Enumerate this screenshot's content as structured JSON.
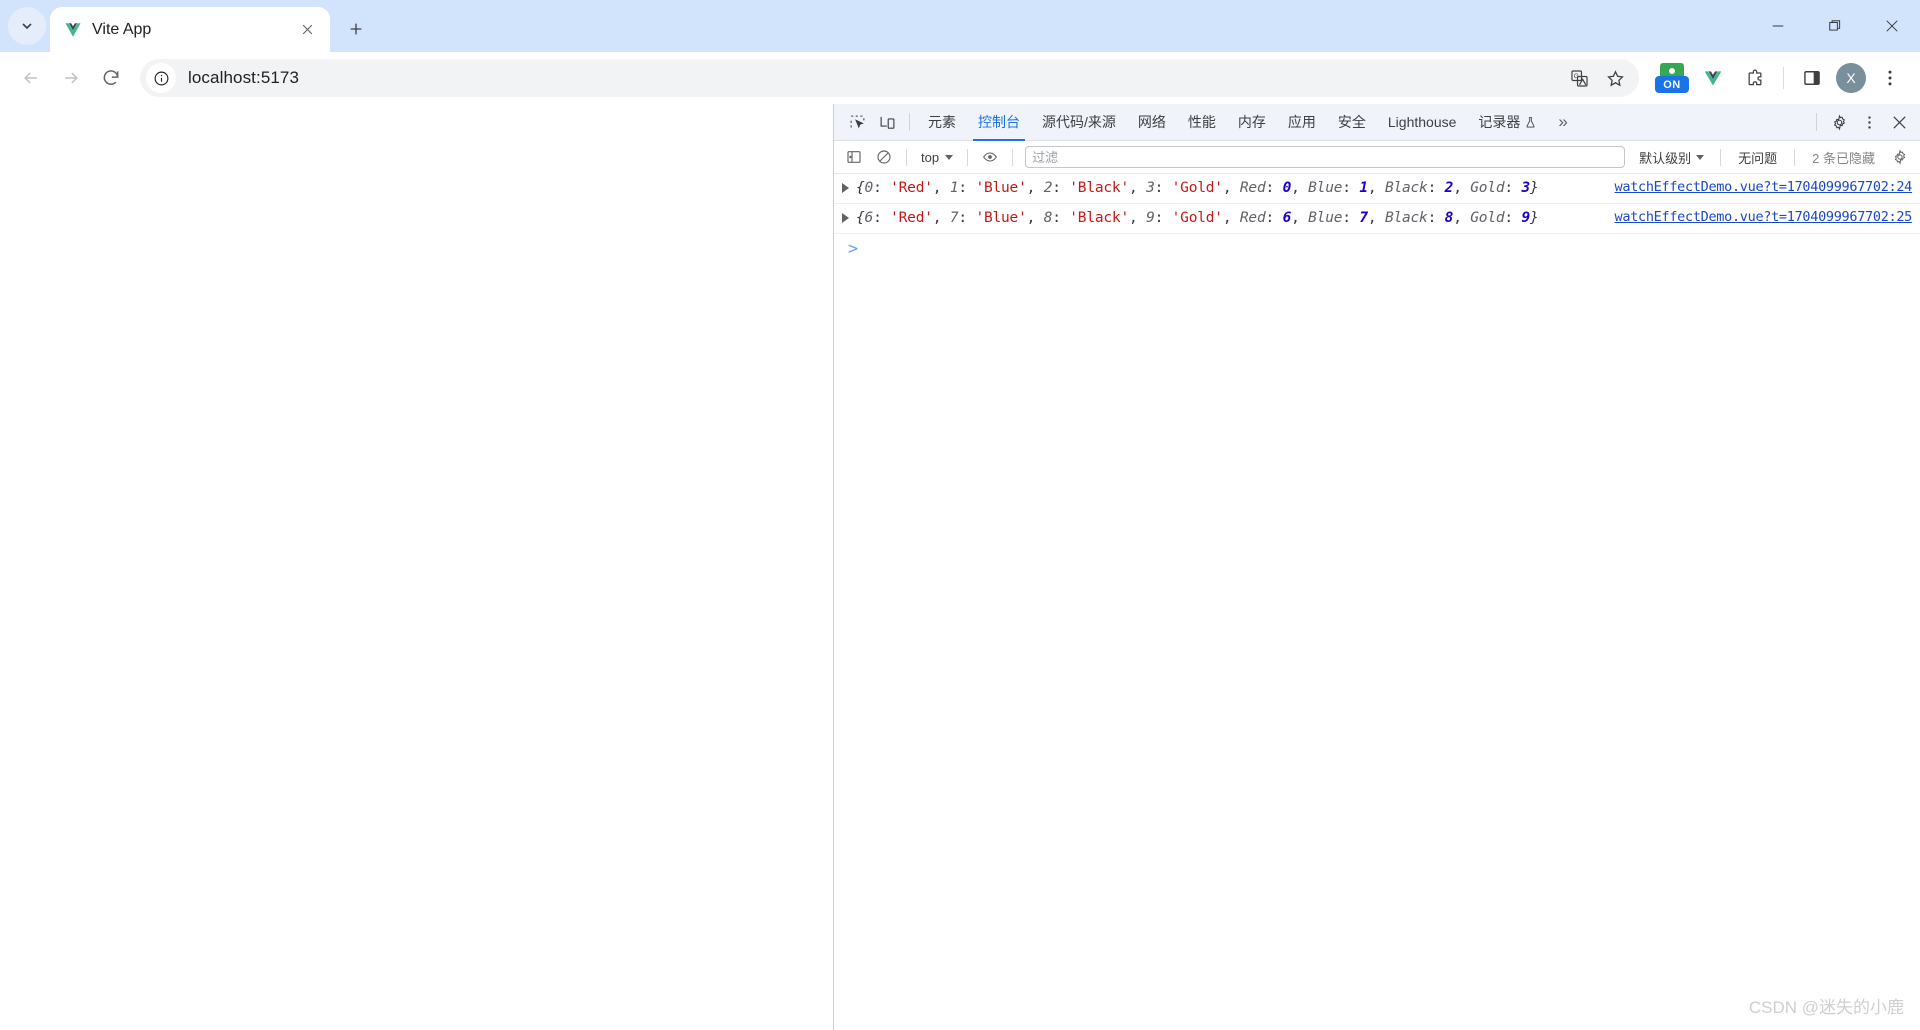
{
  "browser": {
    "tab": {
      "title": "Vite App",
      "favicon": "vue-logo-icon"
    },
    "new_tab_label": "+",
    "window_controls": {
      "minimize": "minimize-icon",
      "maximize": "restore-icon",
      "close": "close-icon"
    },
    "toolbar": {
      "back": "back-arrow-icon",
      "forward": "forward-arrow-icon",
      "reload": "reload-icon",
      "site_info": "info-circle-icon",
      "url": "localhost:5173",
      "translate": "translate-icon",
      "bookmark": "star-icon",
      "extension_on_badge": "ON",
      "vue_devtools": "vue-devtools-icon",
      "extensions": "puzzle-icon",
      "side_panel": "side-panel-icon",
      "profile_initial": "X",
      "menu": "kebab-menu-icon"
    }
  },
  "devtools": {
    "tabs": [
      {
        "label": "元素",
        "active": false
      },
      {
        "label": "控制台",
        "active": true
      },
      {
        "label": "源代码/来源",
        "active": false
      },
      {
        "label": "网络",
        "active": false
      },
      {
        "label": "性能",
        "active": false
      },
      {
        "label": "内存",
        "active": false
      },
      {
        "label": "应用",
        "active": false
      },
      {
        "label": "安全",
        "active": false
      },
      {
        "label": "Lighthouse",
        "active": false
      },
      {
        "label": "记录器",
        "active": false,
        "icon": "flask-icon"
      }
    ],
    "more_tabs": "»",
    "settings_icon": "gear-icon",
    "menu_icon": "kebab-menu-icon",
    "close_icon": "close-icon",
    "inspect_icon": "inspect-element-icon",
    "device_icon": "device-toolbar-icon",
    "filterbar": {
      "sidebar_toggle": "console-sidebar-icon",
      "clear_console": "clear-console-icon",
      "context": "top",
      "eye": "live-expression-icon",
      "filter_placeholder": "过滤",
      "filter_value": "",
      "level": "默认级别",
      "issues": "无问题",
      "hidden_count": "2 条已隐藏",
      "settings": "gear-icon"
    },
    "console_logs": [
      {
        "entries": [
          {
            "key": "0",
            "key_type": "num",
            "value": "'Red'",
            "value_type": "str"
          },
          {
            "key": "1",
            "key_type": "num",
            "value": "'Blue'",
            "value_type": "str"
          },
          {
            "key": "2",
            "key_type": "num",
            "value": "'Black'",
            "value_type": "str"
          },
          {
            "key": "3",
            "key_type": "num",
            "value": "'Gold'",
            "value_type": "str"
          },
          {
            "key": "Red",
            "key_type": "ident",
            "value": "0",
            "value_type": "num"
          },
          {
            "key": "Blue",
            "key_type": "ident",
            "value": "1",
            "value_type": "num"
          },
          {
            "key": "Black",
            "key_type": "ident",
            "value": "2",
            "value_type": "num"
          },
          {
            "key": "Gold",
            "key_type": "ident",
            "value": "3",
            "value_type": "num"
          }
        ],
        "source": "watchEffectDemo.vue?t=1704099967702:24"
      },
      {
        "entries": [
          {
            "key": "6",
            "key_type": "num",
            "value": "'Red'",
            "value_type": "str"
          },
          {
            "key": "7",
            "key_type": "num",
            "value": "'Blue'",
            "value_type": "str"
          },
          {
            "key": "8",
            "key_type": "num",
            "value": "'Black'",
            "value_type": "str"
          },
          {
            "key": "9",
            "key_type": "num",
            "value": "'Gold'",
            "value_type": "str"
          },
          {
            "key": "Red",
            "key_type": "ident",
            "value": "6",
            "value_type": "num"
          },
          {
            "key": "Blue",
            "key_type": "ident",
            "value": "7",
            "value_type": "num"
          },
          {
            "key": "Black",
            "key_type": "ident",
            "value": "8",
            "value_type": "num"
          },
          {
            "key": "Gold",
            "key_type": "ident",
            "value": "9",
            "value_type": "num"
          }
        ],
        "source": "watchEffectDemo.vue?t=1704099967702:25"
      }
    ],
    "prompt": ">"
  },
  "watermark": "CSDN @迷失的小鹿"
}
